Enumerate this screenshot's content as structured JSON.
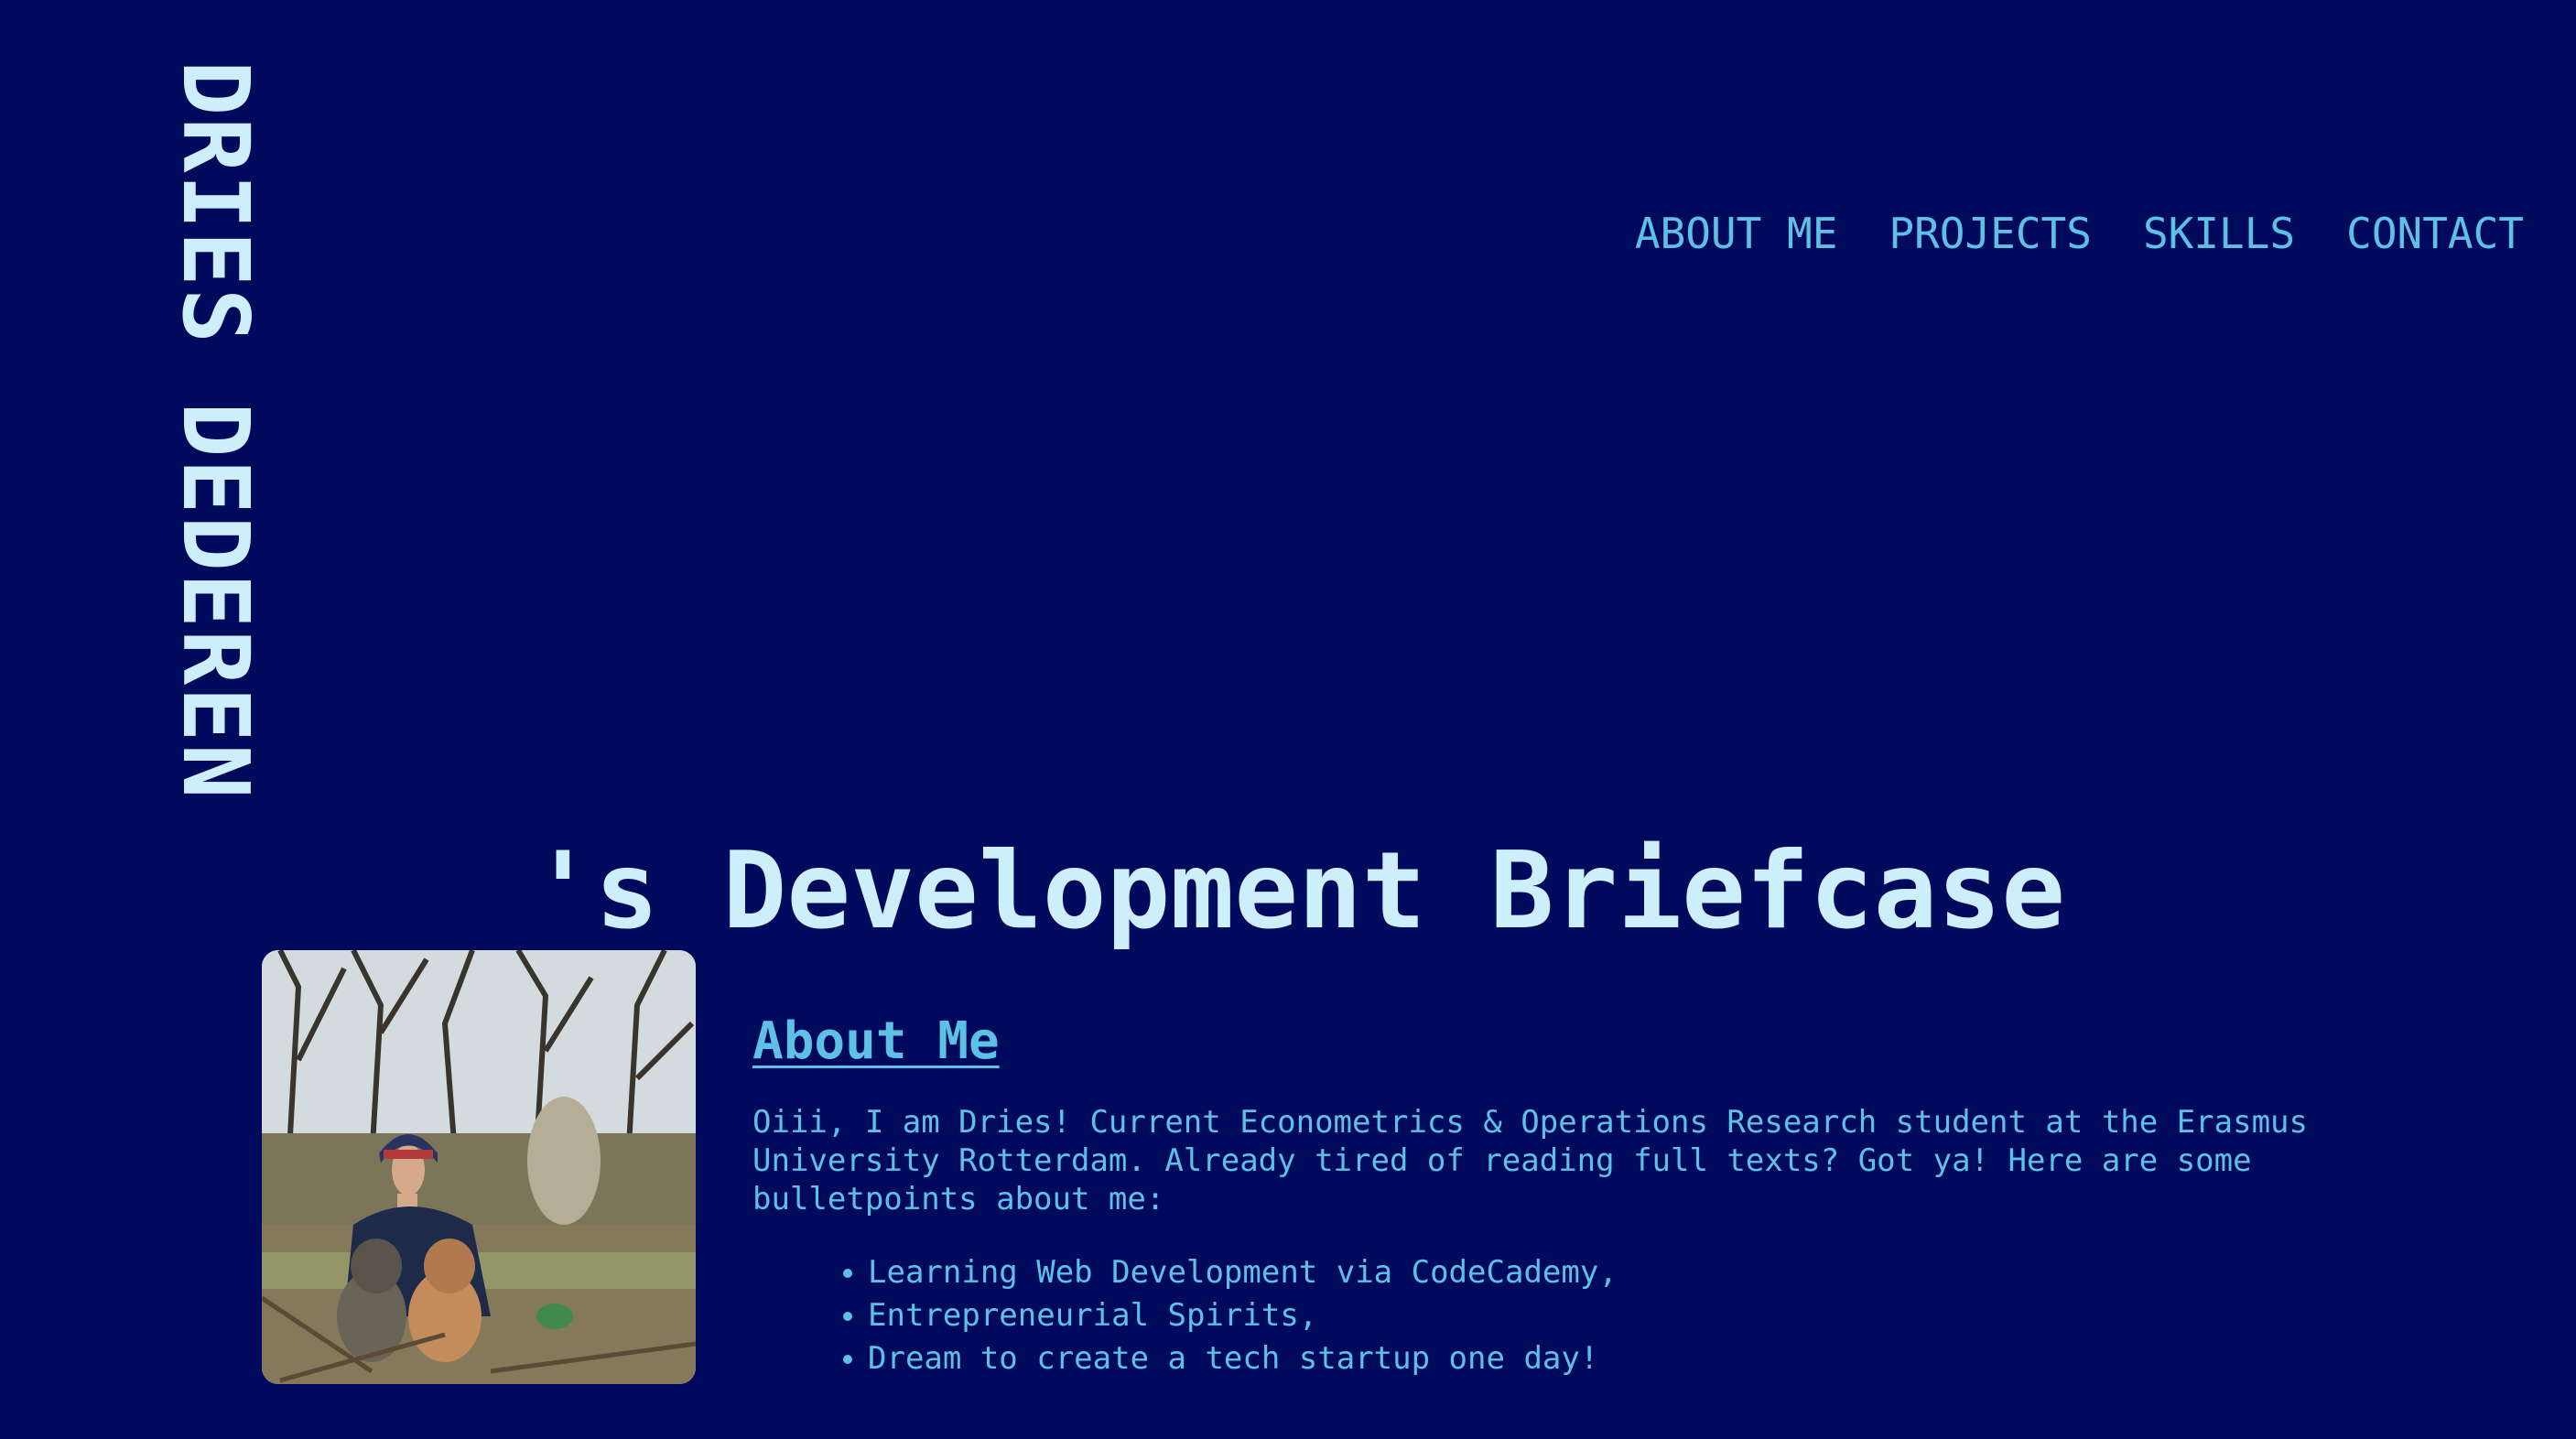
{
  "brand": {
    "name": "DRIES DEDEREN"
  },
  "nav": {
    "items": [
      {
        "label": "ABOUT ME"
      },
      {
        "label": "PROJECTS"
      },
      {
        "label": "SKILLS"
      },
      {
        "label": "CONTACT"
      }
    ]
  },
  "hero": {
    "headline": "'s Development Briefcase"
  },
  "about": {
    "photo_icon": "portrait-with-dogs-photo",
    "title": "About Me",
    "intro": "Oiii, I am Dries! Current Econometrics & Operations Research student at the Erasmus University Rotterdam. Already tired of reading full texts? Got ya! Here are some bulletpoints about me:",
    "bullets": [
      "Learning Web Development via CodeCademy,",
      "Entrepreneurial Spirits,",
      "Dream to create a tech startup one day!"
    ]
  },
  "colors": {
    "background": "#000a5c",
    "light_text": "#cdeffb",
    "accent_text": "#5fc0e6"
  }
}
